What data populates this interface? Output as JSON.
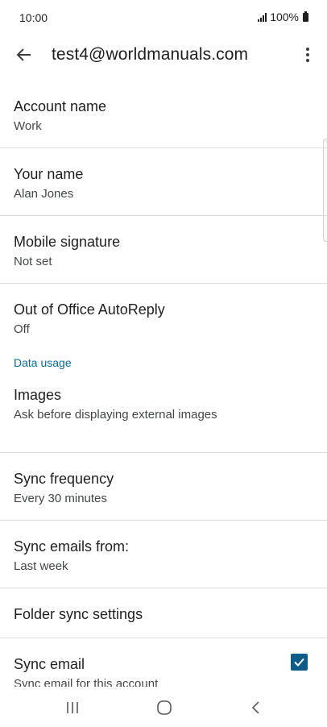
{
  "status_bar": {
    "time": "10:00",
    "battery": "100%"
  },
  "app_bar": {
    "title": "test4@worldmanuals.com"
  },
  "settings": {
    "account_name": {
      "title": "Account name",
      "value": "Work"
    },
    "your_name": {
      "title": "Your name",
      "value": "Alan Jones"
    },
    "mobile_signature": {
      "title": "Mobile signature",
      "value": "Not set"
    },
    "out_of_office": {
      "title": "Out of Office AutoReply",
      "value": "Off"
    },
    "data_usage_header": "Data usage",
    "images": {
      "title": "Images",
      "value": "Ask before displaying external images"
    },
    "sync_frequency": {
      "title": "Sync frequency",
      "value": "Every 30 minutes"
    },
    "sync_emails_from": {
      "title": "Sync emails from:",
      "value": "Last week"
    },
    "folder_sync": {
      "title": "Folder sync settings"
    },
    "sync_email": {
      "title": "Sync email",
      "value": "Sync email for this account",
      "checked": true
    }
  },
  "colors": {
    "accent": "#0b5c88",
    "section_header": "#0b6a8f"
  },
  "icons": {
    "back": "arrow-left",
    "menu": "more-vert",
    "check": "check",
    "nav_recent": "recent-apps",
    "nav_home": "home",
    "nav_back": "chevron-left"
  }
}
